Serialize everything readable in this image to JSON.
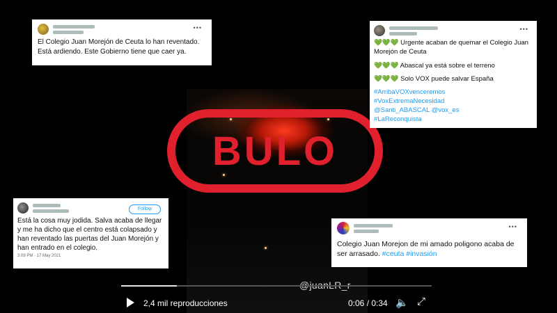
{
  "video": {
    "watermark": "@juanLR_r",
    "views": "2,4 mil reproducciones",
    "time": "0:06 / 0:34",
    "progress_fraction": 0.18,
    "icons": {
      "play": "play-icon",
      "volume": "volume-icon",
      "fullscreen": "fullscreen-icon"
    }
  },
  "stamp": {
    "text": "BULO",
    "color": "#e0202c"
  },
  "tweets": {
    "t1": {
      "text": "El Colegio Juan Morejón de Ceuta lo han reventado. Está ardiendo. Este Gobierno tiene que caer ya."
    },
    "t2": {
      "hearts": "💚💚💚",
      "line1": "Urgente acaban de quemar el Colegio Juan Morejón de Ceuta",
      "line2": "Abascal ya está sobre el terreno",
      "line3": "Solo VOX puede salvar España",
      "tag1": "#ArribaVOXvenceremos",
      "tag2": "#VoxExtremaNecesidad",
      "tag3": "@Santi_ABASCAL @vox_es",
      "tag4": "#LaReconquista"
    },
    "t3": {
      "follow": "Follow",
      "text": "Está la cosa muy jodida. Salva acaba de llegar y me ha dicho que el centro está colapsado y han reventado las puertas del Juan Morejón y han entrado en el colegio.",
      "meta": "3:09 PM · 17 May 2021"
    },
    "t4": {
      "text": "Colegio Juan Morejon de mi amado poligono  acaba de ser arrasado.",
      "tags": "#ceuta #invasión"
    }
  }
}
